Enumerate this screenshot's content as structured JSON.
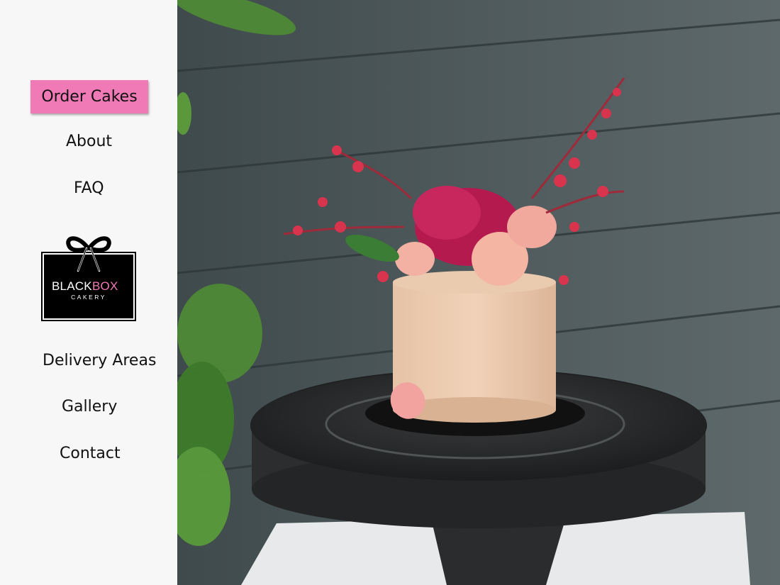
{
  "nav": {
    "order_cakes": "Order Cakes",
    "about": "About",
    "faq": "FAQ",
    "delivery_areas": "Delivery Areas",
    "gallery": "Gallery",
    "contact": "Contact"
  },
  "logo": {
    "word_black": "BLACK",
    "word_box": "BOX",
    "word_cakery": "CAKERY"
  },
  "colors": {
    "accent_pink": "#f07ab5",
    "sidebar_bg": "#f7f7f7",
    "logo_bg": "#000000"
  }
}
